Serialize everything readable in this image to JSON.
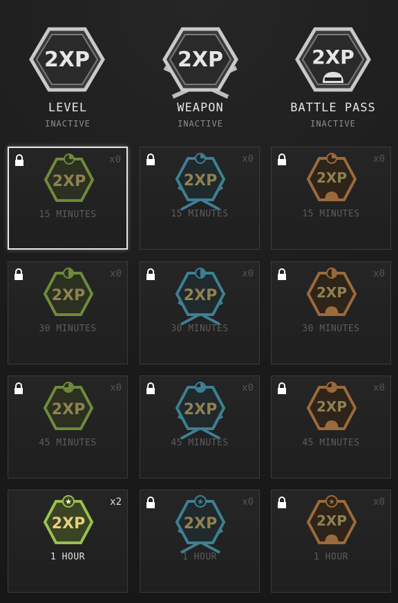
{
  "header": {
    "tokens": [
      {
        "label": "2XP",
        "title": "LEVEL",
        "status": "INACTIVE",
        "icon": "level-2xp-token-icon"
      },
      {
        "label": "2XP",
        "title": "WEAPON",
        "status": "INACTIVE",
        "icon": "weapon-2xp-token-icon"
      },
      {
        "label": "2XP",
        "title": "BATTLE PASS",
        "status": "INACTIVE",
        "icon": "battle-pass-2xp-token-icon"
      }
    ]
  },
  "colors": {
    "level": "#6f8a3c",
    "weapon": "#3f7f92",
    "battle_pass": "#9b6a3c",
    "gold_text": "#c8b36a",
    "selected_border": "#e8e8e8"
  },
  "grid": {
    "columns": [
      "level",
      "weapon",
      "battle_pass"
    ],
    "rows": [
      {
        "duration": "15 MINUTES",
        "cells": [
          {
            "label": "2XP",
            "count": "x0",
            "locked": true,
            "selected": true
          },
          {
            "label": "2XP",
            "count": "x0",
            "locked": true
          },
          {
            "label": "2XP",
            "count": "x0",
            "locked": true
          }
        ]
      },
      {
        "duration": "30 MINUTES",
        "cells": [
          {
            "label": "2XP",
            "count": "x0",
            "locked": true
          },
          {
            "label": "2XP",
            "count": "x0",
            "locked": true
          },
          {
            "label": "2XP",
            "count": "x0",
            "locked": true
          }
        ]
      },
      {
        "duration": "45 MINUTES",
        "cells": [
          {
            "label": "2XP",
            "count": "x0",
            "locked": true
          },
          {
            "label": "2XP",
            "count": "x0",
            "locked": true
          },
          {
            "label": "2XP",
            "count": "x0",
            "locked": true
          }
        ]
      },
      {
        "duration": "1 HOUR",
        "cells": [
          {
            "label": "2XP",
            "count": "x2",
            "locked": false,
            "active": true
          },
          {
            "label": "2XP",
            "count": "x0",
            "locked": true
          },
          {
            "label": "2XP",
            "count": "x0",
            "locked": true
          }
        ]
      }
    ]
  }
}
